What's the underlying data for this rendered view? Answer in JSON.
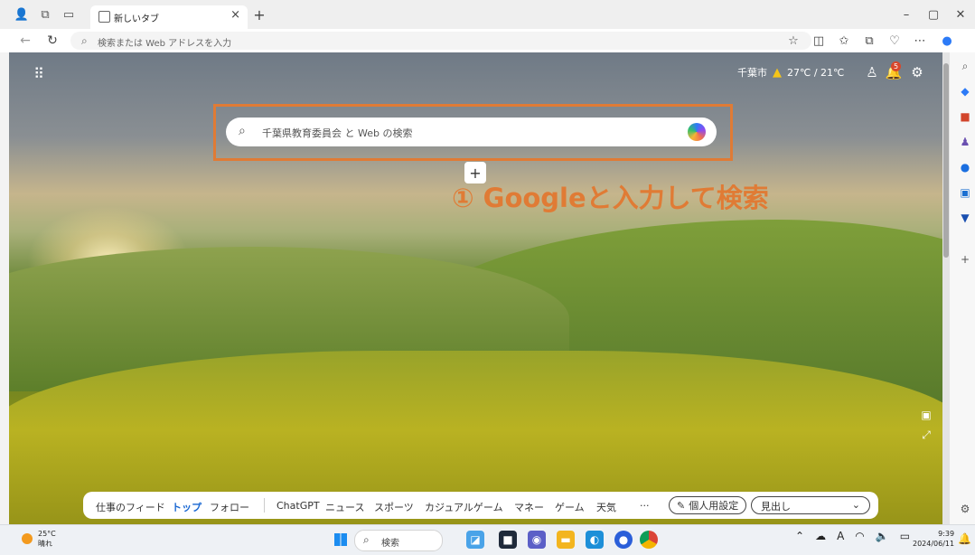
{
  "browser": {
    "tab": {
      "title": "新しいタブ"
    },
    "window_controls": {
      "minimize": "–",
      "restore": "▢",
      "close": "✕"
    },
    "address_bar": {
      "placeholder": "検索または Web アドレスを入力"
    }
  },
  "new_tab_page": {
    "weather": {
      "city": "千葉市",
      "temps": "27℃ / 21℃"
    },
    "notification_count": "5",
    "search": {
      "placeholder": "千葉県教育委員会 と Web の検索"
    },
    "add_shortcut": "+",
    "annotation": "① Googleと入力して検索",
    "feed": {
      "tabs": [
        {
          "label": "仕事のフィード"
        },
        {
          "label": "トップ"
        },
        {
          "label": "フォロー"
        },
        {
          "label": "ChatGPT"
        },
        {
          "label": "ニュース"
        },
        {
          "label": "スポーツ"
        },
        {
          "label": "カジュアルゲーム"
        },
        {
          "label": "マネー"
        },
        {
          "label": "ゲーム"
        },
        {
          "label": "天気"
        }
      ],
      "more": "···",
      "personalize": "個人用設定",
      "headline_select": "見出し"
    }
  },
  "taskbar": {
    "weather": {
      "temp": "25°C",
      "condition": "晴れ"
    },
    "search": {
      "placeholder": "検索"
    },
    "clock": {
      "time": "9:39",
      "date": "2024/06/11"
    }
  },
  "colors": {
    "annotation": "#e07b35",
    "highlight_border": "#e07b35",
    "feed_active": "#1967d2"
  }
}
